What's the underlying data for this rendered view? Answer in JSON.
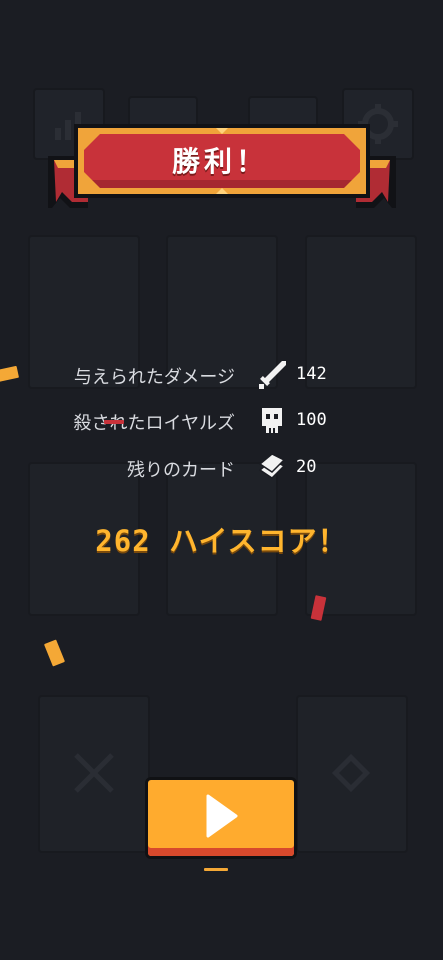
{
  "banner": {
    "title": "勝利！"
  },
  "stats": [
    {
      "label": "与えられたダメージ",
      "icon": "sword-icon",
      "value": "142"
    },
    {
      "label": "殺されたロイヤルズ",
      "icon": "skull-icon",
      "value": "100"
    },
    {
      "label": "残りのカード",
      "icon": "cards-icon",
      "value": "20"
    }
  ],
  "highscore": {
    "text": "262 ハイスコア！"
  },
  "play_button": {
    "icon": "play-icon"
  },
  "colors": {
    "background": "#1b1d23",
    "banner_red": "#c8323a",
    "banner_gold": "#f0a43a",
    "highscore": "#ffb52e",
    "play_button": "#ffab2e",
    "play_button_bottom": "#d8492c"
  }
}
